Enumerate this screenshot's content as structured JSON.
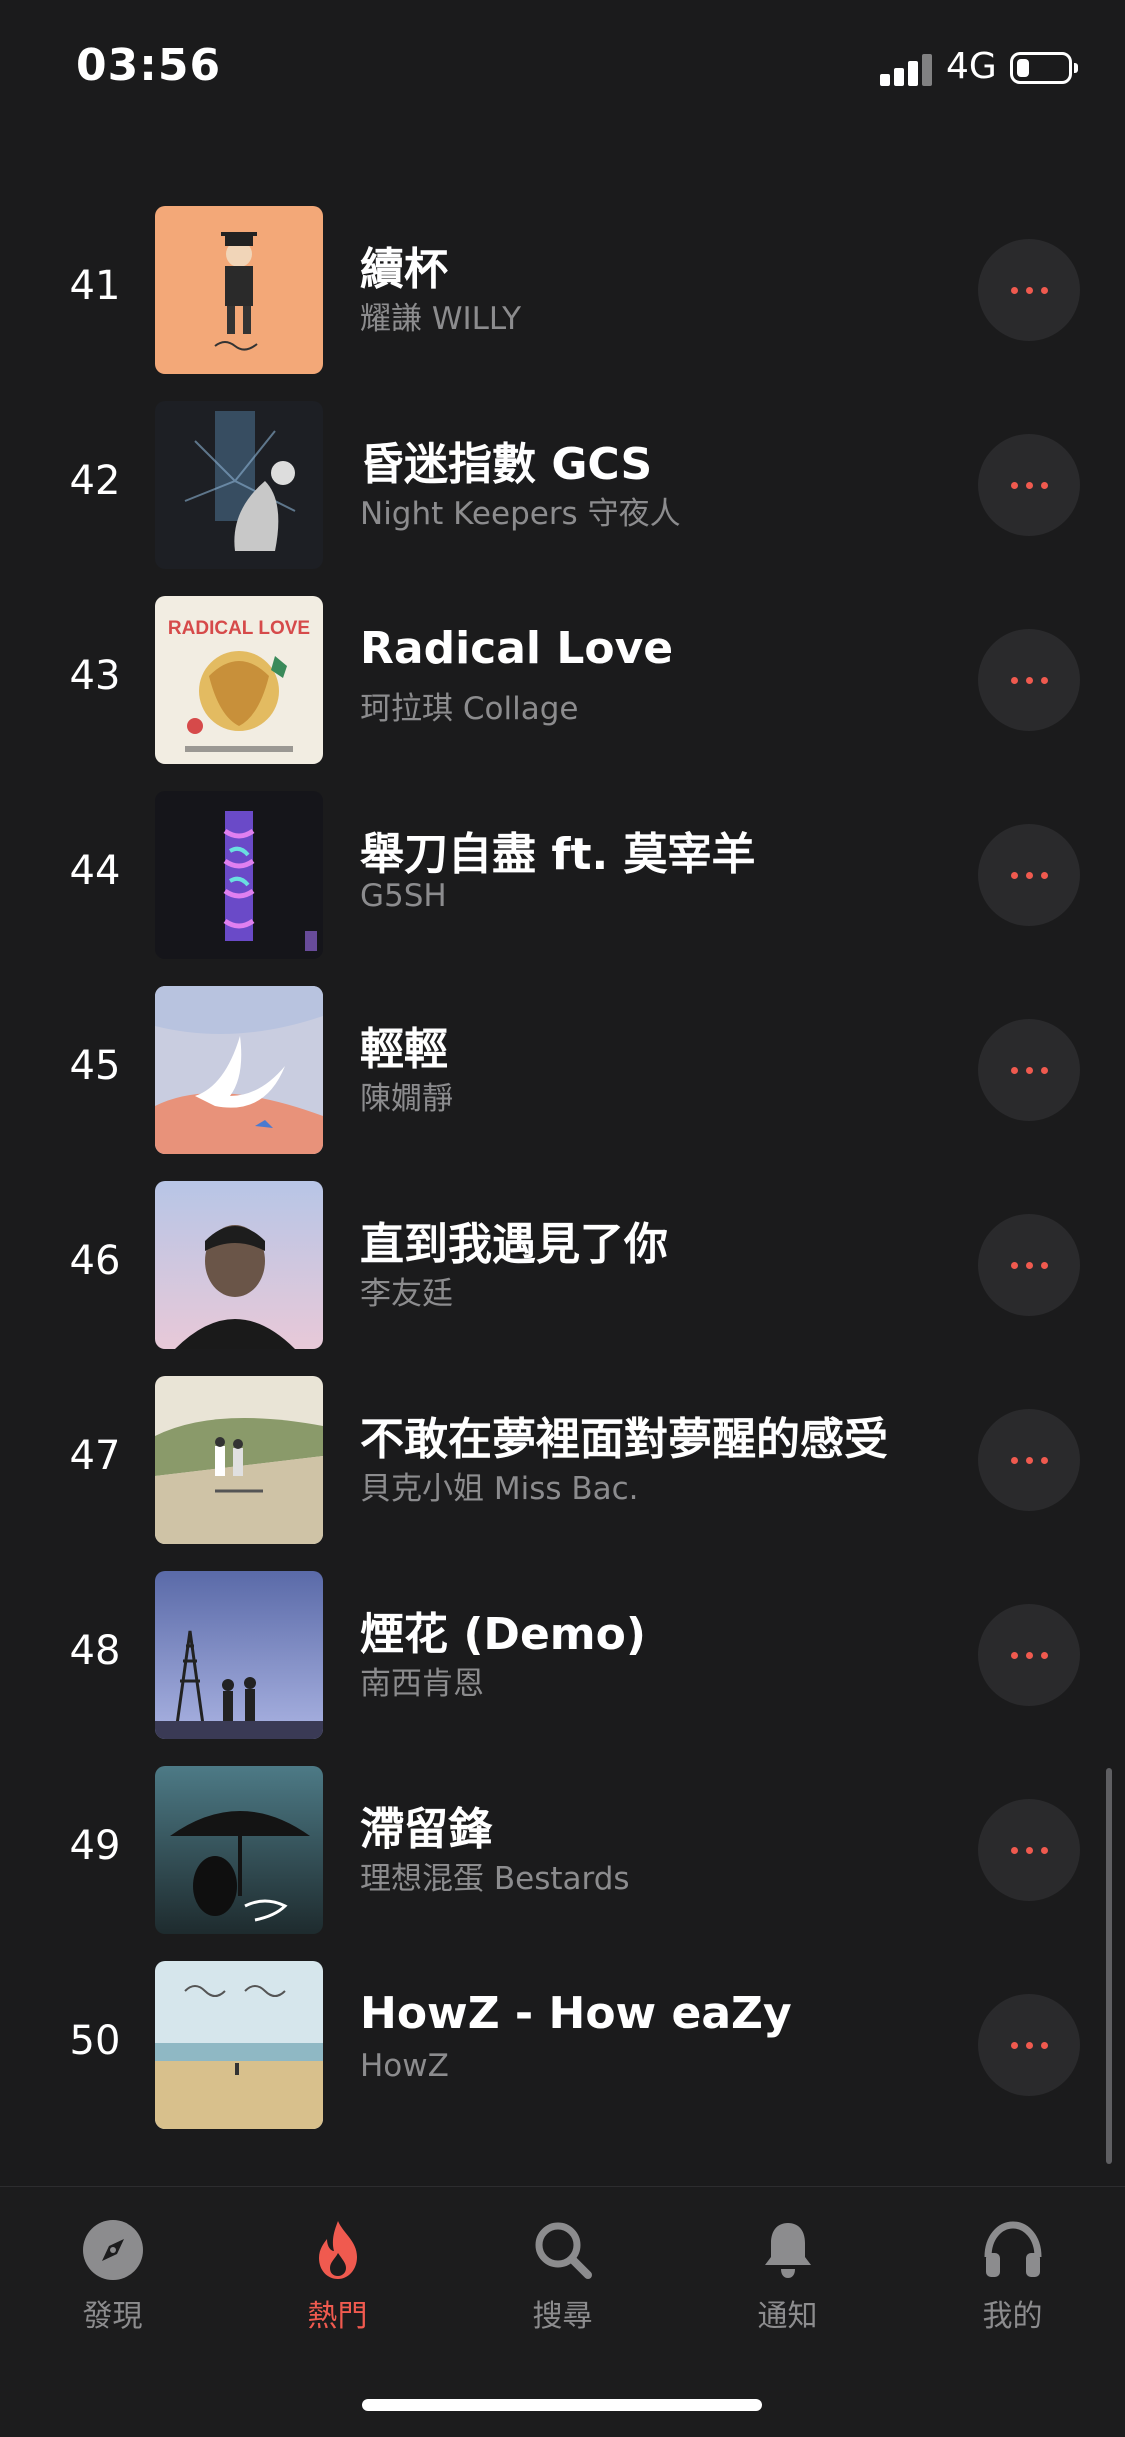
{
  "status_bar": {
    "time": "03:56",
    "network": "4G",
    "battery_level": 0.25
  },
  "colors": {
    "background": "#1b1b1c",
    "accent": "#f05a4f",
    "secondary_text": "#8c8c8e"
  },
  "tracks": [
    {
      "rank": "41",
      "title": "續杯",
      "artist": "耀謙 WILLY"
    },
    {
      "rank": "42",
      "title": "昏迷指數 GCS",
      "artist": "Night Keepers 守夜人"
    },
    {
      "rank": "43",
      "title": "Radical Love",
      "artist": "珂拉琪 Collage",
      "art_text": "RADICAL LOVE"
    },
    {
      "rank": "44",
      "title": "舉刀自盡 ft. 莫宰羊",
      "artist": "G5SH"
    },
    {
      "rank": "45",
      "title": "輕輕",
      "artist": "陳嫺靜"
    },
    {
      "rank": "46",
      "title": "直到我遇見了你",
      "artist": "李友廷"
    },
    {
      "rank": "47",
      "title": "不敢在夢裡面對夢醒的感受",
      "artist": "貝克小姐 Miss Bac."
    },
    {
      "rank": "48",
      "title": "煙花 (Demo)",
      "artist": "南西肯恩"
    },
    {
      "rank": "49",
      "title": "滯留鋒",
      "artist": "理想混蛋 Bestards"
    },
    {
      "rank": "50",
      "title": "HowZ - How eaZy",
      "artist": "HowZ"
    }
  ],
  "tabs": [
    {
      "label": "發現",
      "icon": "compass-icon",
      "active": false
    },
    {
      "label": "熱門",
      "icon": "flame-icon",
      "active": true
    },
    {
      "label": "搜尋",
      "icon": "search-icon",
      "active": false
    },
    {
      "label": "通知",
      "icon": "bell-icon",
      "active": false
    },
    {
      "label": "我的",
      "icon": "headphones-icon",
      "active": false
    }
  ]
}
